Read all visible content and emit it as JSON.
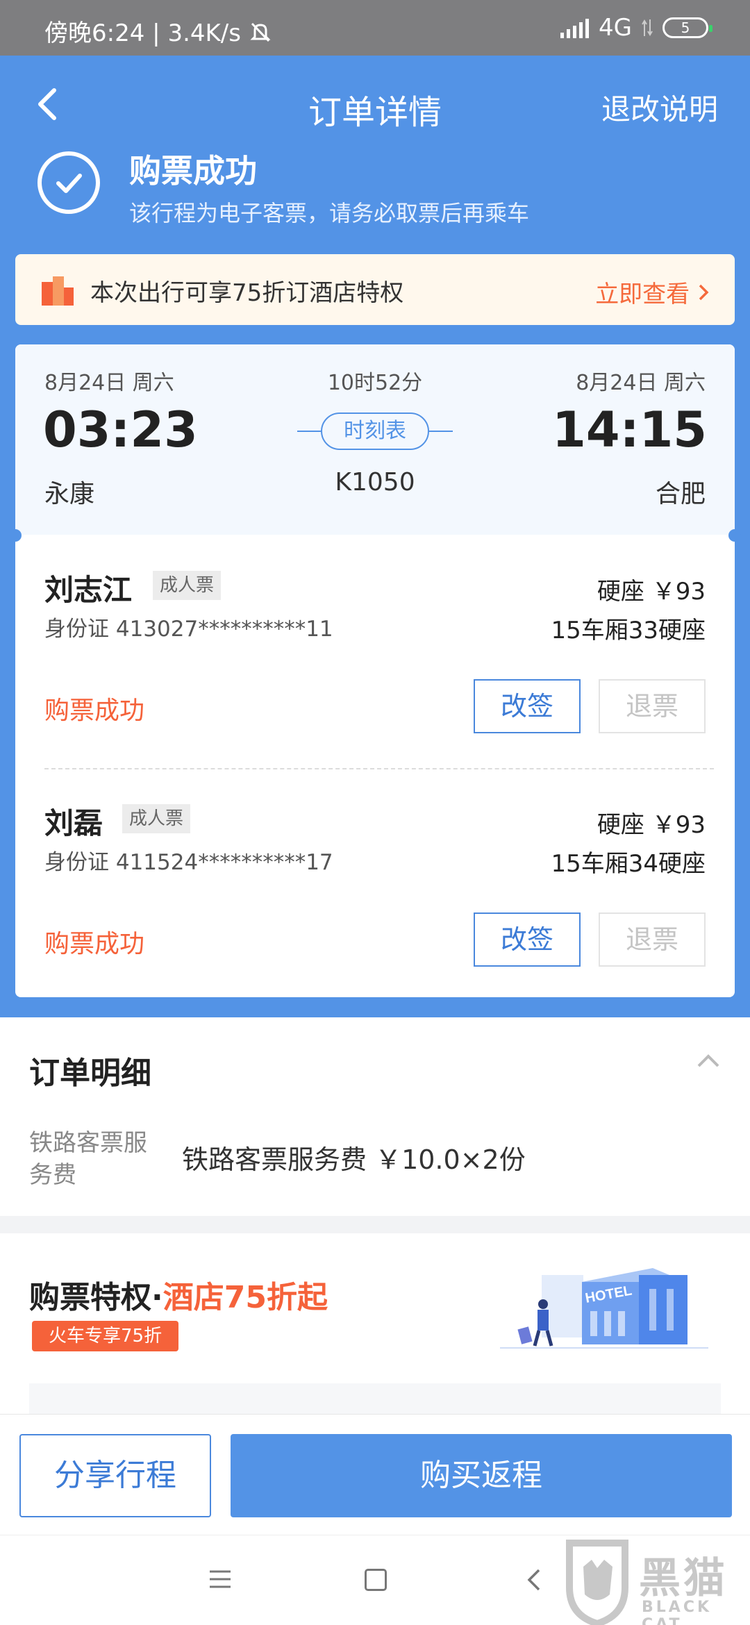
{
  "status_bar": {
    "time": "傍晚6:24",
    "speed": "3.4K/s",
    "network": "4G",
    "battery": "5"
  },
  "nav": {
    "title": "订单详情",
    "refund_note": "退改说明"
  },
  "success": {
    "title": "购票成功",
    "subtitle": "该行程为电子客票，请务必取票后再乘车"
  },
  "promo": {
    "text": "本次出行可享75折订酒店特权",
    "action": "立即查看 "
  },
  "trip": {
    "dep_date": "8月24日  周六",
    "arr_date": "8月24日  周六",
    "duration": "10时52分",
    "dep_time": "03:23",
    "arr_time": "14:15",
    "timetable": "时刻表",
    "dep_station": "永康",
    "arr_station": "合肥",
    "train_no": "K1050"
  },
  "passengers": [
    {
      "name": "刘志江",
      "type": "成人票",
      "seat_class": "硬座  ￥93",
      "id": "身份证  413027**********11",
      "seat": "15车厢33硬座",
      "status": "购票成功",
      "change": "改签",
      "refund": "退票"
    },
    {
      "name": "刘磊",
      "type": "成人票",
      "seat_class": "硬座  ￥93",
      "id": "身份证  411524**********17",
      "seat": "15车厢34硬座",
      "status": "购票成功",
      "change": "改签",
      "refund": "退票"
    }
  ],
  "order_detail": {
    "title": "订单明细",
    "label": "铁路客票服务费",
    "value": "铁路客票服务费 ￥10.0×2份"
  },
  "perk": {
    "title_prefix": "购票特权·",
    "title_highlight": "酒店75折起",
    "tag": "火车专享75折",
    "hotel_sign": "HOTEL"
  },
  "bottom": {
    "share": "分享行程",
    "return": "购买返程"
  },
  "watermark": {
    "brand": "黑猫",
    "en": "BLACK CAT"
  },
  "colors": {
    "primary": "#5393e6",
    "accent": "#f5623a"
  }
}
